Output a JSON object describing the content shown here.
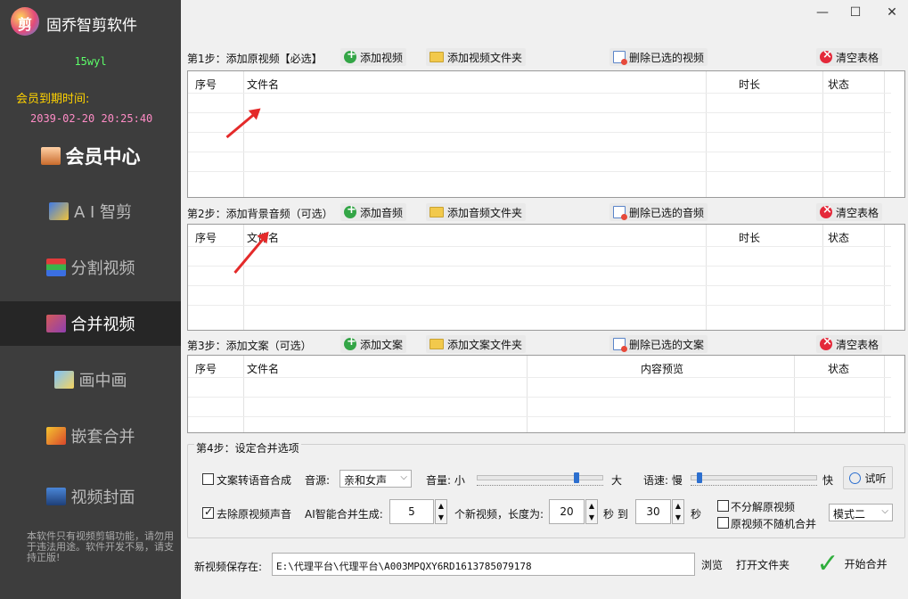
{
  "app": {
    "title": "固乔智剪软件"
  },
  "window": {
    "minimize": "—",
    "maximize": "☐",
    "close": "✕"
  },
  "sidebar": {
    "user": "15wyl",
    "vip_label": "会员到期时间:",
    "vip_expire": "2039-02-20 20:25:40",
    "items": [
      {
        "label": "会员中心",
        "icon": "vip-person-icon"
      },
      {
        "label": "A I 智剪",
        "icon": "ai-icon"
      },
      {
        "label": "分割视频",
        "icon": "split-icon"
      },
      {
        "label": "合并视频",
        "icon": "merge-icon",
        "active": true
      },
      {
        "label": "画中画",
        "icon": "pip-icon"
      },
      {
        "label": "嵌套合并",
        "icon": "nest-icon"
      },
      {
        "label": "视频封面",
        "icon": "cover-icon"
      }
    ],
    "note": "本软件只有视频剪辑功能，请勿用于违法用途。软件开发不易，请支持正版!"
  },
  "step1": {
    "label": "第1步：添加原视频【必选】",
    "add": "添加视频",
    "add_folder": "添加视频文件夹",
    "delete": "删除已选的视频",
    "clear": "清空表格",
    "columns": [
      "序号",
      "文件名",
      "时长",
      "状态"
    ]
  },
  "step2": {
    "label": "第2步：添加背景音频（可选）",
    "add": "添加音频",
    "add_folder": "添加音频文件夹",
    "delete": "删除已选的音频",
    "clear": "清空表格",
    "columns": [
      "序号",
      "文件名",
      "时长",
      "状态"
    ]
  },
  "step3": {
    "label": "第3步：添加文案（可选）",
    "add": "添加文案",
    "add_folder": "添加文案文件夹",
    "delete": "删除已选的文案",
    "clear": "清空表格",
    "columns": [
      "序号",
      "文件名",
      "内容预览",
      "状态"
    ]
  },
  "step4": {
    "label": "第4步：设定合并选项",
    "tts": "文案转语音合成",
    "voice_label": "音源:",
    "voice_value": "亲和女声",
    "volume_label": "音量: 小",
    "volume_max": "大",
    "volume_level": 0.8,
    "speed_label": "语速: 慢",
    "speed_max": "快",
    "speed_level": 0.05,
    "try_listen": "试听",
    "remove_audio": "去除原视频声音",
    "ai_gen_label": "AI智能合并生成:",
    "count_value": "5",
    "count_suffix": "个新视频，长度为:",
    "min_len": "20",
    "to_label": "秒 到",
    "max_len": "30",
    "sec_label": "秒",
    "no_split": "不分解原视频",
    "no_random": "原视频不随机合并",
    "mode_value": "模式二"
  },
  "save": {
    "label": "新视频保存在:",
    "path": "E:\\代理平台\\代理平台\\A003MPQXY6RD1613785079178",
    "browse": "浏览",
    "open_folder": "打开文件夹",
    "start": "开始合并"
  },
  "colors": {
    "sidebar": "#3d3d3d",
    "active": "#262626",
    "accent": "#2c6fcf",
    "arrow": "#e42a2a"
  }
}
